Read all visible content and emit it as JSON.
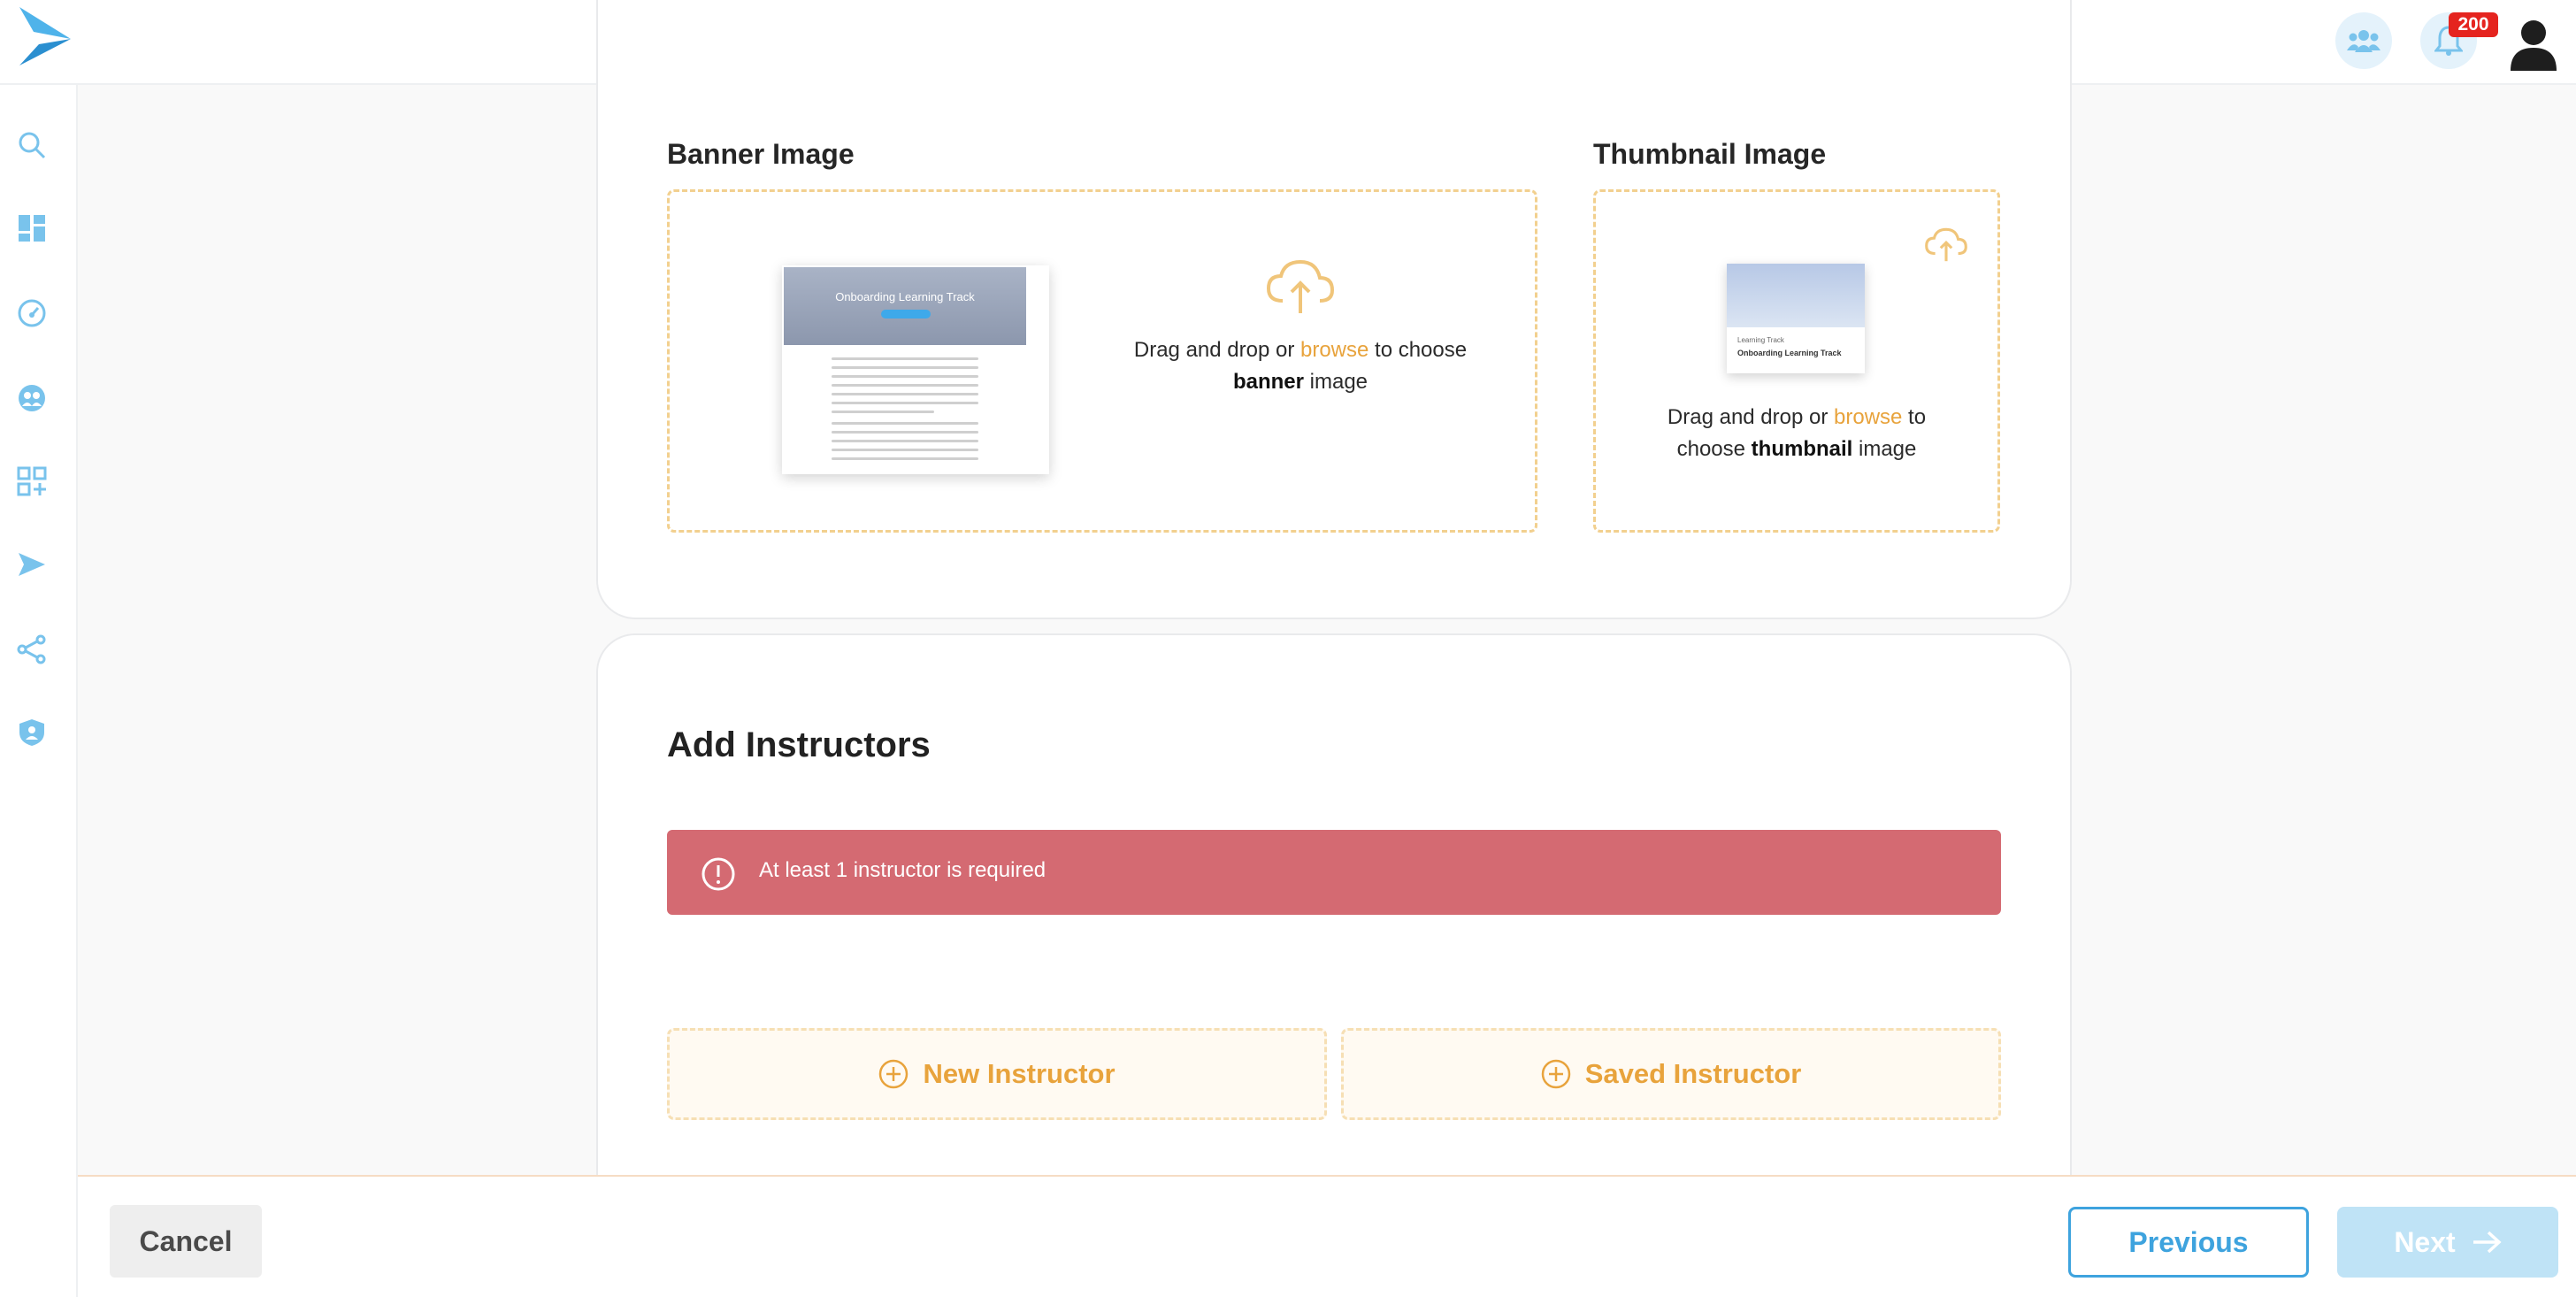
{
  "header": {
    "notification_count": "200"
  },
  "sidebar": {
    "items": [
      {
        "icon": "search-icon"
      },
      {
        "icon": "dashboard-icon"
      },
      {
        "icon": "dial-icon"
      },
      {
        "icon": "users-icon"
      },
      {
        "icon": "add-app-icon"
      },
      {
        "icon": "send-icon"
      },
      {
        "icon": "share-icon"
      },
      {
        "icon": "shield-user-icon"
      }
    ]
  },
  "banner": {
    "label": "Banner Image",
    "preview_title": "Onboarding Learning Track",
    "text_prefix": "Drag and drop or ",
    "browse": "browse",
    "text_mid": " to choose",
    "bold": "banner",
    "text_suffix": " image"
  },
  "thumbnail": {
    "label": "Thumbnail Image",
    "preview_tag": "Learning Track",
    "preview_title": "Onboarding Learning Track",
    "text_prefix": "Drag and drop or ",
    "browse": "browse",
    "text_mid": " to",
    "text_line2_prefix": "choose ",
    "bold": "thumbnail",
    "text_suffix": " image"
  },
  "instructors": {
    "title": "Add Instructors",
    "error": "At least 1 instructor is required",
    "new_label": "New Instructor",
    "saved_label": "Saved Instructor"
  },
  "footer": {
    "cancel": "Cancel",
    "previous": "Previous",
    "next": "Next"
  },
  "colors": {
    "accent": "#3ea3de",
    "upload_accent": "#e8a33c",
    "error": "#d46a72",
    "badge": "#e5241f"
  }
}
